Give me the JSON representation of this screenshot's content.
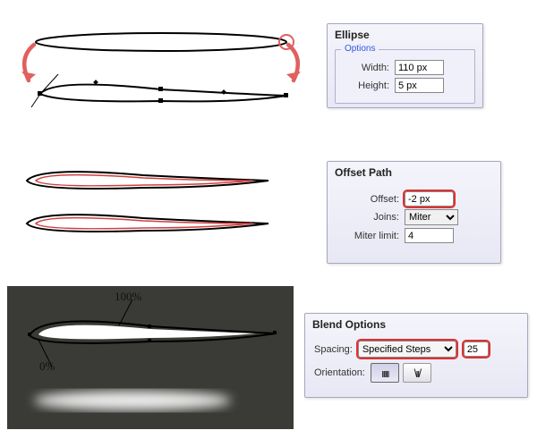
{
  "ellipse_panel": {
    "title": "Ellipse",
    "options_label": "Options",
    "width_label": "Width:",
    "width_value": "110 px",
    "height_label": "Height:",
    "height_value": "5 px"
  },
  "offset_panel": {
    "title": "Offset Path",
    "offset_label": "Offset:",
    "offset_value": "-2 px",
    "joins_label": "Joins:",
    "joins_value": "Miter",
    "miter_label": "Miter limit:",
    "miter_value": "4"
  },
  "blend_panel": {
    "title": "Blend Options",
    "spacing_label": "Spacing:",
    "spacing_value": "Specified Steps",
    "steps_value": "25",
    "orientation_label": "Orientation:"
  },
  "annotations": {
    "hundred": "100%",
    "zero": "0%"
  }
}
